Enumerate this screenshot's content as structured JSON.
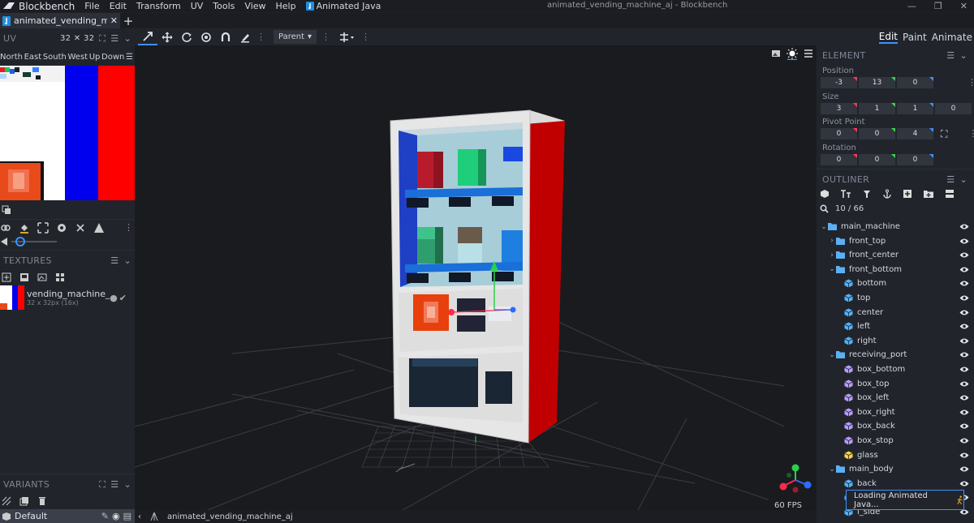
{
  "menubar": {
    "app_name": "Blockbench",
    "menus": [
      "File",
      "Edit",
      "Transform",
      "UV",
      "Tools",
      "View",
      "Help"
    ],
    "plugin_menu": "Animated Java",
    "window_title": "animated_vending_machine_aj - Blockbench"
  },
  "tabs": {
    "active_tab": "animated_vending_machin",
    "new_tab": "+"
  },
  "uv_panel": {
    "title": "UV",
    "grid_size": "32 ✕ 32",
    "faces": [
      "North",
      "East",
      "South",
      "West",
      "Up",
      "Down"
    ]
  },
  "textures_panel": {
    "title": "TEXTURES",
    "texture_name": "vending_machine_tex",
    "texture_info": "32 x 32px (16x)"
  },
  "variants_panel": {
    "title": "VARIANTS",
    "default_variant": "Default"
  },
  "toolbar": {
    "pivot_mode": "Parent"
  },
  "viewport": {
    "fps": "60 FPS"
  },
  "status_bar": {
    "model_name": "animated_vending_machine_aj"
  },
  "mode_tabs": [
    "Edit",
    "Paint",
    "Animate"
  ],
  "element_panel": {
    "title": "ELEMENT",
    "position_label": "Position",
    "position": [
      "-3",
      "13",
      "0"
    ],
    "size_label": "Size",
    "size": [
      "3",
      "1",
      "1",
      "0"
    ],
    "pivot_label": "Pivot Point",
    "pivot": [
      "0",
      "0",
      "4"
    ],
    "rotation_label": "Rotation",
    "rotation": [
      "0",
      "0",
      "0"
    ]
  },
  "outliner": {
    "title": "OUTLINER",
    "count": "10 / 66",
    "items": [
      {
        "label": "main_machine",
        "type": "group",
        "depth": 0,
        "expanded": true
      },
      {
        "label": "front_top",
        "type": "group",
        "depth": 1,
        "expanded": false
      },
      {
        "label": "front_center",
        "type": "group",
        "depth": 1,
        "expanded": false
      },
      {
        "label": "front_bottom",
        "type": "group",
        "depth": 1,
        "expanded": true
      },
      {
        "label": "bottom",
        "type": "cube",
        "depth": 2,
        "color": "#4fb3ff"
      },
      {
        "label": "top",
        "type": "cube",
        "depth": 2,
        "color": "#4fb3ff"
      },
      {
        "label": "center",
        "type": "cube",
        "depth": 2,
        "color": "#4fb3ff"
      },
      {
        "label": "left",
        "type": "cube",
        "depth": 2,
        "color": "#4fb3ff"
      },
      {
        "label": "right",
        "type": "cube",
        "depth": 2,
        "color": "#4fb3ff"
      },
      {
        "label": "receiving_port",
        "type": "group",
        "depth": 1,
        "expanded": true
      },
      {
        "label": "box_bottom",
        "type": "cube",
        "depth": 2,
        "color": "#b99bff"
      },
      {
        "label": "box_top",
        "type": "cube",
        "depth": 2,
        "color": "#b99bff"
      },
      {
        "label": "box_left",
        "type": "cube",
        "depth": 2,
        "color": "#b99bff"
      },
      {
        "label": "box_right",
        "type": "cube",
        "depth": 2,
        "color": "#b99bff"
      },
      {
        "label": "box_back",
        "type": "cube",
        "depth": 2,
        "color": "#b99bff"
      },
      {
        "label": "box_stop",
        "type": "cube",
        "depth": 2,
        "color": "#b99bff"
      },
      {
        "label": "glass",
        "type": "cube",
        "depth": 2,
        "color": "#ffd23f"
      },
      {
        "label": "main_body",
        "type": "group",
        "depth": 1,
        "expanded": true
      },
      {
        "label": "back",
        "type": "cube",
        "depth": 2,
        "color": "#4fb3ff"
      },
      {
        "label": "",
        "type": "cube",
        "depth": 2,
        "color": "#4fb3ff"
      },
      {
        "label": "l_side",
        "type": "cube",
        "depth": 2,
        "color": "#4fb3ff"
      }
    ]
  },
  "toast": {
    "text": "Loading Animated Java..."
  },
  "colors": {
    "accent": "#3e90ff",
    "panel": "#21252b",
    "viewport": "#191b1f",
    "machine_red": "#cc0000",
    "machine_white": "#e9e9e9"
  }
}
